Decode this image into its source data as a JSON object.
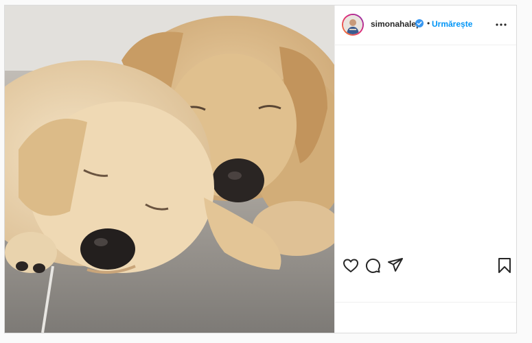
{
  "post": {
    "username": "simonahalep",
    "separator": "•",
    "follow_label": "Urmărește",
    "photo_subject": "two sleeping labrador puppies",
    "verified_icon": "verified-badge-icon",
    "more_icon": "more-options-icon"
  },
  "actions": {
    "like_icon": "heart-icon",
    "comment_icon": "comment-icon",
    "share_icon": "share-icon",
    "save_icon": "bookmark-icon"
  },
  "colors": {
    "accent": "#0095f6",
    "verified": "#3897f0",
    "text": "#262626",
    "border": "#dbdbdb"
  }
}
